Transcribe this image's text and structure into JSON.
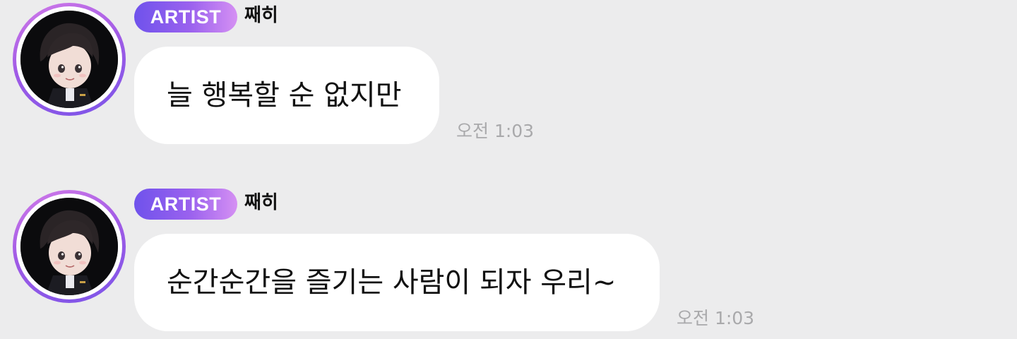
{
  "messages": [
    {
      "badge": "ARTIST",
      "sender": "째히",
      "text": "늘 행복할 순 없지만",
      "time": "오전 1:03",
      "avatar": "avatar-icon"
    },
    {
      "badge": "ARTIST",
      "sender": "째히",
      "text": "순간순간을 즐기는 사람이 되자 우리~",
      "time": "오전 1:03",
      "avatar": "avatar-icon"
    }
  ],
  "colors": {
    "background": "#ececed",
    "bubble": "#ffffff",
    "badge_start": "#6f52ec",
    "badge_end": "#d590f3",
    "timestamp": "#a9a9ab"
  }
}
